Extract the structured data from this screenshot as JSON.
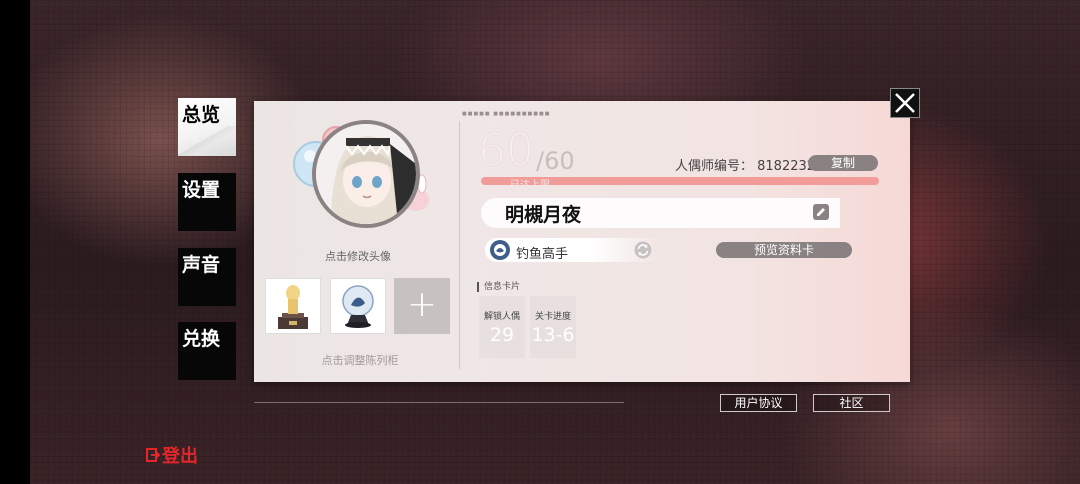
{
  "side_tabs": [
    {
      "label": "总览",
      "active": true
    },
    {
      "label": "设置",
      "active": false
    },
    {
      "label": "声音",
      "active": false
    },
    {
      "label": "兑换",
      "active": false
    }
  ],
  "logout_label": "登出",
  "avatar": {
    "label": "点击修改头像"
  },
  "showcase": {
    "label": "点击调整陈列柜",
    "add_symbol": "+"
  },
  "profile": {
    "tiny_text": "■■■■■ ■■■■■■■■■■",
    "level": "60",
    "level_max": "/60",
    "level_sub": "已达上限",
    "exp_progress": 1.0,
    "id_label": "人偶师编号： 8182232",
    "copy_label": "复制",
    "name": "明槻月夜",
    "title": "钓鱼高手",
    "preview_label": "预览资料卡"
  },
  "info_section": {
    "label": "信息卡片",
    "cards": [
      {
        "label": "解锁人偶",
        "value": "29"
      },
      {
        "label": "关卡进度",
        "value": "13-6"
      }
    ]
  },
  "bottom": {
    "agreement_label": "用户协议",
    "community_label": "社区"
  },
  "colors": {
    "logout_red": "#e4262a",
    "exp_fill": "#f29c9a",
    "button_gray": "#8a8282"
  }
}
